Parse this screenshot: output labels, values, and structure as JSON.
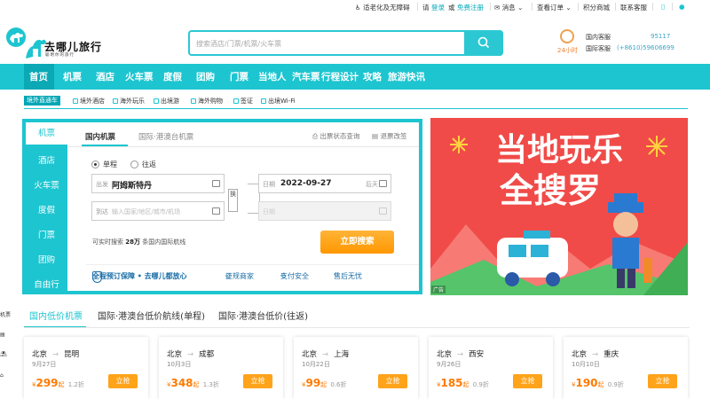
{
  "topbar": {
    "accessibility": "适老化及无障碍",
    "please": "请",
    "login": "登录",
    "or": "或",
    "register": "免费注册",
    "messages": "消息",
    "orders": "查看订单",
    "points_mall": "积分商城",
    "contact": "联系客服"
  },
  "header": {
    "logo_name": "去哪儿旅行",
    "logo_slogan": "聪明你的旅行",
    "search_placeholder": "搜索酒店/门票/机票/火车票",
    "hotline": {
      "label_24h": "24小时",
      "domestic_label": "国内客服",
      "domestic_number": "95117",
      "intl_label": "国际客服",
      "intl_number": "(+8610)59606699"
    }
  },
  "nav": [
    "首页",
    "机票",
    "酒店",
    "火车票",
    "度假",
    "团购",
    "门票",
    "当地人",
    "汽车票",
    "行程设计",
    "攻略",
    "旅游快讯"
  ],
  "subnav": {
    "badge": "境外直通车",
    "items": [
      "境外酒店",
      "海外玩乐",
      "出境游",
      "海外购物",
      "签证",
      "出境Wi-Fi"
    ]
  },
  "booking": {
    "side": [
      "机票",
      "酒店",
      "火车票",
      "度假",
      "门票",
      "团购",
      "自由行"
    ],
    "tabs": [
      "国内机票",
      "国际·港澳台机票"
    ],
    "flight_status": "出票状态查询",
    "refund": "退票改签",
    "trip_type": [
      "单程",
      "往返"
    ],
    "from_label": "出发",
    "from_value": "阿姆斯特丹",
    "to_label": "到达",
    "to_placeholder": "输入国家/地区/城市/机场",
    "date_label": "日期",
    "date_value": "2022-09-27",
    "day_after": "后天",
    "return_label": "日期",
    "swap": "换",
    "note_pre": "可实时搜索",
    "note_num": "28万",
    "note_post": "条国内国际航线",
    "search_button": "立即搜索",
    "guarantees": [
      "全程预订保障 • 去哪儿都放心",
      "正规商家",
      "支付安全",
      "售后无忧"
    ]
  },
  "banner": {
    "line1": "当地玩乐",
    "line2": "全搜罗",
    "ad": "广告"
  },
  "lowprice": {
    "tabs": [
      "国内低价机票",
      "国际·港澳台低价航线(单程)",
      "国际·港澳台低价(往返)"
    ],
    "side_labels": [
      "机票"
    ],
    "cards": [
      {
        "from": "北京",
        "to": "昆明",
        "date": "9月27日",
        "price": "299",
        "qi": "起",
        "discount": "1.2折",
        "button": "立抢"
      },
      {
        "from": "北京",
        "to": "成都",
        "date": "10月3日",
        "price": "348",
        "qi": "起",
        "discount": "1.3折",
        "button": "立抢"
      },
      {
        "from": "北京",
        "to": "上海",
        "date": "10月22日",
        "price": "99",
        "qi": "起",
        "discount": "0.6折",
        "button": "立抢"
      },
      {
        "from": "北京",
        "to": "西安",
        "date": "9月26日",
        "price": "185",
        "qi": "起",
        "discount": "0.9折",
        "button": "立抢"
      },
      {
        "from": "北京",
        "to": "重庆",
        "date": "10月10日",
        "price": "190",
        "qi": "起",
        "discount": "0.9折",
        "button": "立抢"
      }
    ]
  },
  "colors": {
    "brand": "#1dc5d0",
    "accent_orange": "#ff9700",
    "banner_red": "#f04b48"
  }
}
